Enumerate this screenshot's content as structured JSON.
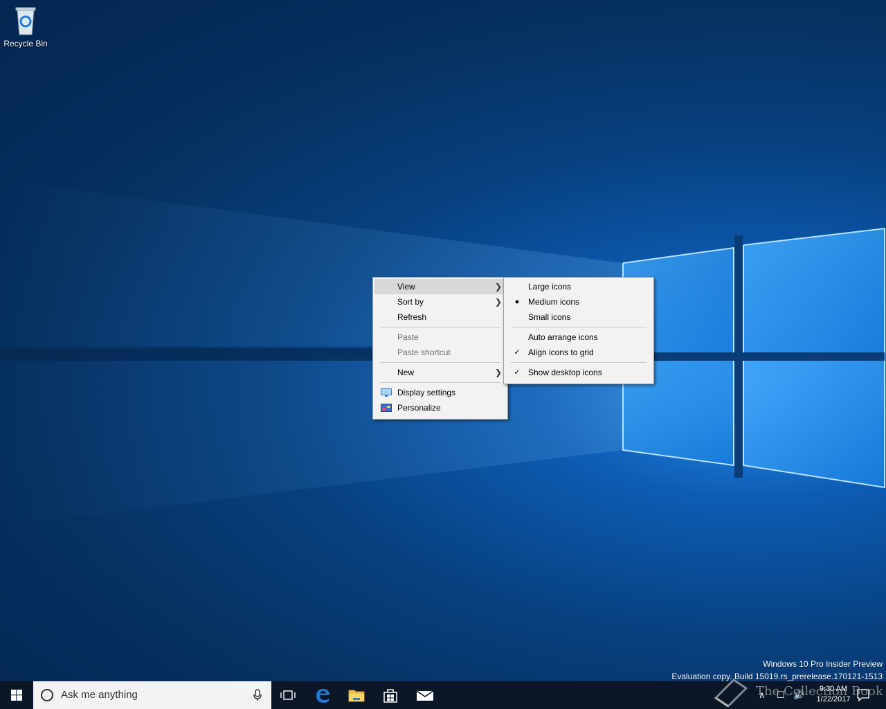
{
  "desktop": {
    "recycle_bin_label": "Recycle Bin"
  },
  "context_menu": {
    "items": [
      {
        "label": "View",
        "has_submenu": true,
        "highlighted": true
      },
      {
        "label": "Sort by",
        "has_submenu": true
      },
      {
        "label": "Refresh"
      },
      {
        "label": "Paste",
        "disabled": true
      },
      {
        "label": "Paste shortcut",
        "disabled": true
      },
      {
        "label": "New",
        "has_submenu": true
      },
      {
        "label": "Display settings",
        "icon": "display-icon"
      },
      {
        "label": "Personalize",
        "icon": "personalize-icon"
      }
    ]
  },
  "view_submenu": {
    "items": [
      {
        "label": "Large icons"
      },
      {
        "label": "Medium icons",
        "marker": "radio-dot"
      },
      {
        "label": "Small icons"
      },
      {
        "label": "Auto arrange icons"
      },
      {
        "label": "Align icons to grid",
        "marker": "checkmark"
      },
      {
        "label": "Show desktop icons",
        "marker": "checkmark"
      }
    ]
  },
  "watermark": {
    "line1": "Windows 10 Pro Insider Preview",
    "line2": "Evaluation copy. Build 15019.rs_prerelease.170121-1513"
  },
  "taskbar": {
    "search_placeholder": "Ask me anything",
    "clock_time": "9:30 AM",
    "clock_date": "1/22/2017",
    "pinned": [
      "task-view-icon",
      "edge-icon",
      "file-explorer-icon",
      "store-icon",
      "mail-icon"
    ]
  },
  "overlay_brand": "The Collection Book",
  "colors": {
    "taskbar": "#0b1726",
    "menu_bg": "#f2f2f2",
    "menu_highlight": "#d8d8d8",
    "edge_blue": "#1e78d6",
    "folder_yellow": "#f0c24a"
  }
}
